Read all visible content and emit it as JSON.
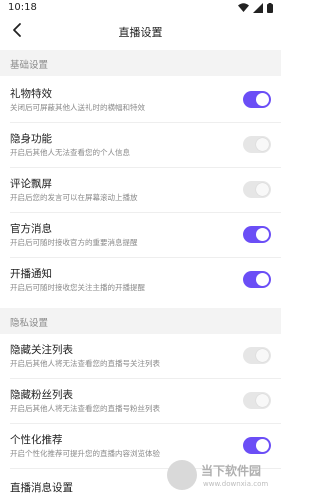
{
  "status": {
    "time": "10:18"
  },
  "nav": {
    "title": "直播设置"
  },
  "sections": {
    "basic": "基础设置",
    "privacy": "隐私设置"
  },
  "items": [
    {
      "label": "礼物特效",
      "desc": "关闭后可屏蔽其他人送礼时的横幅和特效",
      "enabled": true
    },
    {
      "label": "隐身功能",
      "desc": "开启后其他人无法查看您的个人信息",
      "enabled": false
    },
    {
      "label": "评论飘屏",
      "desc": "开启后您的发言可以在屏幕滚动上播放",
      "enabled": false
    },
    {
      "label": "官方消息",
      "desc": "开启后可随时接收官方的重要消息提醒",
      "enabled": true
    },
    {
      "label": "开播通知",
      "desc": "开启后可随时接收您关注主播的开播提醒",
      "enabled": true
    },
    {
      "label": "隐藏关注列表",
      "desc": "开启后其他人将无法查看您的直播号关注列表",
      "enabled": false
    },
    {
      "label": "隐藏粉丝列表",
      "desc": "开启后其他人将无法查看您的直播号粉丝列表",
      "enabled": false
    },
    {
      "label": "个性化推荐",
      "desc": "开启个性化推荐可提升您的直播内容浏览体验",
      "enabled": true
    },
    {
      "label": "直播消息设置",
      "desc": "",
      "enabled": null
    }
  ],
  "watermark": {
    "name": "当下软件园",
    "url": "www.downxia.com"
  },
  "colors": {
    "accent": "#6b4ef6",
    "section_bg": "#f3f3f3"
  }
}
